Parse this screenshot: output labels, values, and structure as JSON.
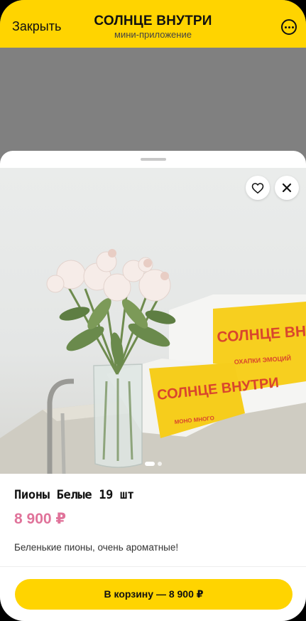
{
  "header": {
    "close_label": "Закрыть",
    "title": "СОЛНЦЕ ВНУТРИ",
    "subtitle": "мини-приложение",
    "more_icon": "more-icon"
  },
  "product": {
    "name": "Пионы Белые 19 шт",
    "price": "8 900 ₽",
    "description": "Беленькие пионы, очень ароматные!",
    "photo_pager": {
      "count": 2,
      "active": 1
    },
    "box_brand_text": "СОЛНЦЕ ВНУТРИ",
    "box_small_text_1": "ОХАПКИ ЭМОЦИЙ",
    "box_small_text_2": "МОНО МНОГО"
  },
  "actions": {
    "favorite_icon": "heart-icon",
    "close_icon": "close-icon",
    "cart_label": "В корзину — 8 900 ₽"
  },
  "colors": {
    "accent": "#ffd400",
    "price": "#e0739a"
  }
}
